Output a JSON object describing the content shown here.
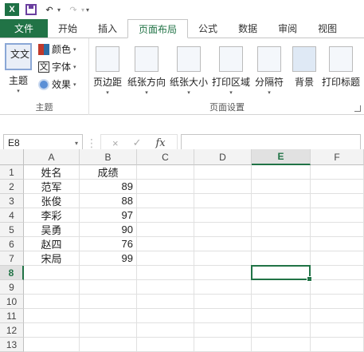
{
  "qat": {
    "logo": "X"
  },
  "tabs": [
    "文件",
    "开始",
    "插入",
    "页面布局",
    "公式",
    "数据",
    "审阅",
    "视图"
  ],
  "active_tab": "页面布局",
  "ribbon": {
    "theme_group": {
      "label": "主题",
      "theme_button": "主题",
      "theme_icon_text": "文文",
      "colors": "颜色",
      "fonts": "字体",
      "font_icon_text": "文",
      "effects": "效果"
    },
    "page_setup_group": {
      "label": "页面设置",
      "buttons": [
        "页边距",
        "纸张方向",
        "纸张大小",
        "打印区域",
        "分隔符",
        "背景",
        "打印标题"
      ]
    }
  },
  "formula_bar": {
    "name_box": "E8",
    "cancel": "×",
    "confirm": "✓",
    "fx": "fx",
    "value": ""
  },
  "sheet": {
    "columns": [
      "A",
      "B",
      "C",
      "D",
      "E",
      "F"
    ],
    "selected_column": "E",
    "rows": [
      "1",
      "2",
      "3",
      "4",
      "5",
      "6",
      "7",
      "8",
      "9",
      "10",
      "11",
      "12",
      "13"
    ],
    "selected_row": "8",
    "selected_cell": "E8",
    "data": [
      [
        "姓名",
        "成绩"
      ],
      [
        "范军",
        "89"
      ],
      [
        "张俊",
        "88"
      ],
      [
        "李彩",
        "97"
      ],
      [
        "吴勇",
        "90"
      ],
      [
        "赵四",
        "76"
      ],
      [
        "宋局",
        "99"
      ]
    ]
  }
}
